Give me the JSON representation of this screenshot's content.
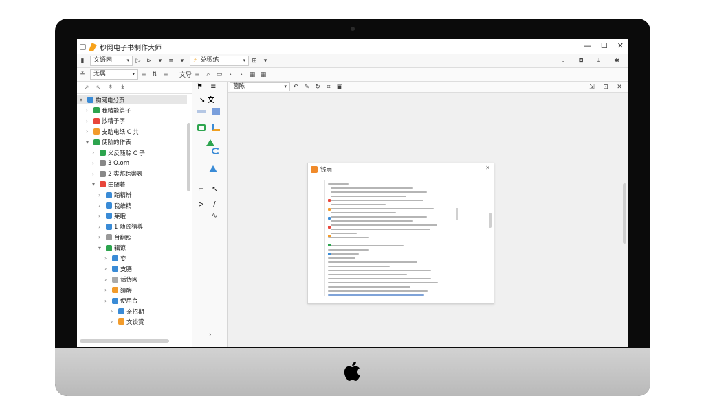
{
  "app": {
    "title": "秒网电子书制作大师"
  },
  "window_controls": [
    "—",
    "☐",
    "✕"
  ],
  "toolbar1": {
    "style_dropdown": "文语网",
    "font_dropdown": "兑稠练",
    "right_icons": [
      "search-icon",
      "tag-icon",
      "pin-icon",
      "star-icon"
    ]
  },
  "toolbar2": {
    "left_dropdown": "无属",
    "section_label": "文导"
  },
  "left_pane": {
    "tree": [
      {
        "label": "构网电分页",
        "level": 0,
        "selected": true,
        "icon": "#3a8bd6"
      },
      {
        "label": "我精能第子",
        "level": 1,
        "icon": "#2da44e"
      },
      {
        "label": "抄精子字",
        "level": 1,
        "icon": "#e8463b"
      },
      {
        "label": "支助电纸 C 共",
        "level": 1,
        "icon": "#f29b2b"
      },
      {
        "label": "使阶的作表",
        "level": 1,
        "icon": "#2da44e"
      },
      {
        "label": "义反随赊 C 子",
        "level": 2,
        "icon": "#2da44e"
      },
      {
        "label": "3 Q.om",
        "level": 2,
        "icon": "#888888"
      },
      {
        "label": "2 实邦跨崇表",
        "level": 2,
        "icon": "#888888"
      },
      {
        "label": "田随着",
        "level": 2,
        "icon": "#e8463b"
      },
      {
        "label": "踏精辨",
        "level": 3,
        "icon": "#3a8bd6"
      },
      {
        "label": "我维精",
        "level": 3,
        "icon": "#3a8bd6"
      },
      {
        "label": "莱哦",
        "level": 3,
        "icon": "#3a8bd6"
      },
      {
        "label": "1 随顾猜尊",
        "level": 3,
        "icon": "#3a8bd6"
      },
      {
        "label": "台翻照",
        "level": 3,
        "icon": "#999999"
      },
      {
        "label": "辑谅",
        "level": 3,
        "icon": "#2da44e"
      },
      {
        "label": "变",
        "level": 4,
        "icon": "#3a8bd6"
      },
      {
        "label": "支膳",
        "level": 4,
        "icon": "#3a8bd6"
      },
      {
        "label": "话伪网",
        "level": 4,
        "icon": "#aaaaaa"
      },
      {
        "label": "猜酶",
        "level": 4,
        "icon": "#f29b2b"
      },
      {
        "label": "使用台",
        "level": 4,
        "icon": "#3a8bd6"
      },
      {
        "label": "亲招期",
        "level": 5,
        "icon": "#3a8bd6"
      },
      {
        "label": "文谈賞",
        "level": 5,
        "icon": "#f29b2b"
      }
    ]
  },
  "canvas": {
    "zoom_dropdown": "茵陈"
  },
  "dialog": {
    "title": "钱雨"
  }
}
